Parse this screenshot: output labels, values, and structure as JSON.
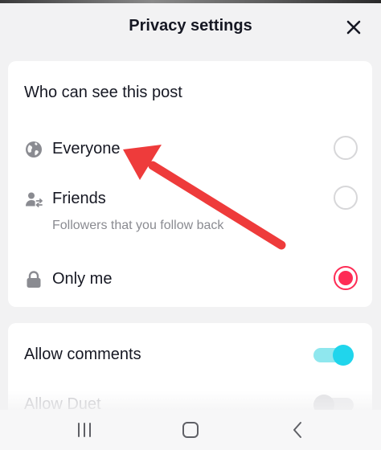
{
  "header": {
    "title": "Privacy settings"
  },
  "visibility": {
    "section_title": "Who can see this post",
    "options": [
      {
        "label": "Everyone",
        "sublabel": "",
        "icon": "globe-icon",
        "selected": false
      },
      {
        "label": "Friends",
        "sublabel": "Followers that you follow back",
        "icon": "friends-icon",
        "selected": false
      },
      {
        "label": "Only me",
        "sublabel": "",
        "icon": "lock-icon",
        "selected": true
      }
    ]
  },
  "interactions": {
    "allow_comments_label": "Allow comments",
    "allow_comments_on": true,
    "allow_duet_label": "Allow Duet",
    "allow_duet_on": false
  },
  "annotation": {
    "arrow_color": "#ee3b3b",
    "points_to": "Everyone"
  },
  "colors": {
    "accent_selected": "#fe2c55",
    "toggle_on": "#20d5ec"
  }
}
